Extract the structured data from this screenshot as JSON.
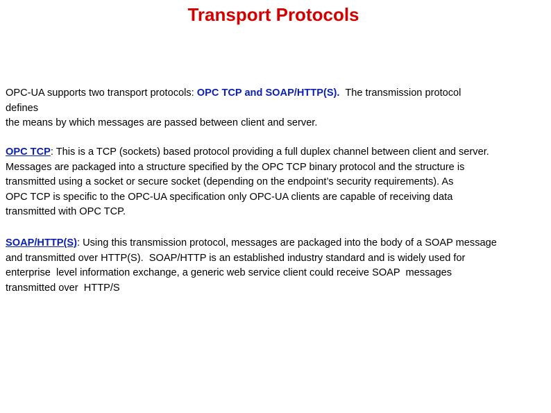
{
  "title": "Transport Protocols",
  "colors": {
    "title": "#d40000",
    "highlight": "#0a1fb0",
    "text": "#000000",
    "background": "#ffffff"
  },
  "intro": {
    "line1_prefix": "OPC-UA supports two transport protocols: ",
    "line1_highlight": "OPC TCP and SOAP/HTTP(S).",
    "line1_suffix": "  The transmission protocol",
    "line2": "defines",
    "line3": "the means by which messages are passed between client and server."
  },
  "opc_tcp": {
    "term": "OPC TCP",
    "line1_rest": ": This is a TCP (sockets) based protocol providing a full duplex channel between client and server.",
    "line2": "Messages are packaged into a structure specified by the OPC TCP binary protocol and the structure is",
    "line3": "transmitted using a socket or secure socket (depending on the endpoint’s security requirements). As",
    "line4": "OPC TCP is specific to the OPC-UA specification only OPC-UA clients are capable of receiving data",
    "line5": "transmitted with OPC TCP."
  },
  "soap_http": {
    "term": "SOAP/HTTP(S)",
    "line1_rest": ": Using this transmission protocol, messages are packaged into the body of a SOAP message",
    "line2": "and transmitted over HTTP(S).  SOAP/HTTP is an established industry standard and is widely used for",
    "line3": "enterprise  level information exchange, a generic web service client could receive SOAP  messages",
    "line4": "transmitted over  HTTP/S"
  }
}
